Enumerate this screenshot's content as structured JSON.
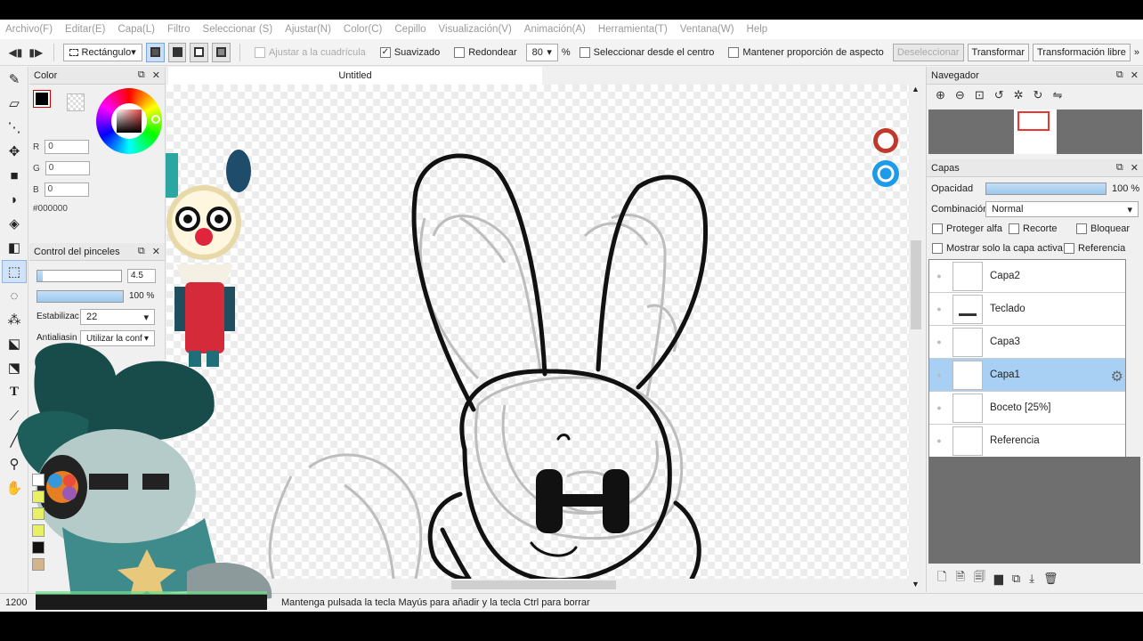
{
  "menu": [
    "Archivo(F)",
    "Editar(E)",
    "Capa(L)",
    "Filtro",
    "Seleccionar (S)",
    "Ajustar(N)",
    "Color(C)",
    "Cepillo",
    "Visualización(V)",
    "Animación(A)",
    "Herramienta(T)",
    "Ventana(W)",
    "Help"
  ],
  "toolbar": {
    "shape_dropdown": "Rectángulo",
    "snap_grid": "Ajustar a la cuadrícula",
    "antialias": "Suavizado",
    "rounded": "Redondear",
    "rounded_value": "80",
    "percent": "%",
    "from_center": "Seleccionar desde el centro",
    "keep_ratio": "Mantener proporción de aspecto",
    "deselect": "Deseleccionar",
    "transform": "Transformar",
    "free_transform": "Transformación libre",
    "more": "»"
  },
  "color_panel": {
    "title": "Color",
    "r_label": "R",
    "r_value": "0",
    "g_label": "G",
    "g_value": "0",
    "b_label": "B",
    "b_value": "0",
    "hex": "#000000",
    "foreground": "#000000"
  },
  "brush_panel": {
    "title": "Control del pinceles",
    "size_value": "4.5",
    "opacity_value": "100 %",
    "opacity_level": 1.0,
    "stabilizer_label": "Estabilizac",
    "stabilizer_value": "22",
    "antialias_label": "Antialiasin",
    "antialias_value": "Utilizar la conf"
  },
  "canvas": {
    "tab_title": "Untitled"
  },
  "status": {
    "zoom": "1200",
    "hint": "Mantenga pulsada la tecla Mayús para añadir y la tecla Ctrl para borrar"
  },
  "navigator": {
    "title": "Navegador"
  },
  "layers": {
    "title": "Capas",
    "opacity_label": "Opacidad",
    "opacity_value": "100 %",
    "opacity_level": 1.0,
    "blend_label": "Combinación",
    "blend_value": "Normal",
    "protect_alpha": "Proteger alfa",
    "clip": "Recorte",
    "lock": "Bloquear",
    "show_only": "Mostrar solo la capa activa",
    "reference": "Referencia",
    "items": [
      {
        "name": "Capa2",
        "selected": false
      },
      {
        "name": "Teclado",
        "selected": false
      },
      {
        "name": "Capa3",
        "selected": false
      },
      {
        "name": "Capa1",
        "selected": true
      },
      {
        "name": "Boceto [25%]",
        "selected": false
      },
      {
        "name": "Referencia",
        "selected": false
      }
    ]
  }
}
